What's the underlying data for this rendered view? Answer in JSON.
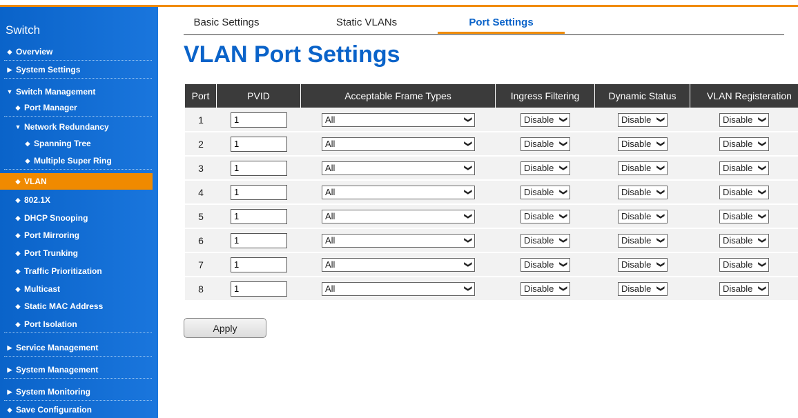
{
  "sidebar": {
    "title": "Switch",
    "items": [
      {
        "label": "Overview",
        "marker": "◆"
      },
      {
        "label": "System Settings",
        "marker": "▶"
      },
      {
        "label": "Switch Management",
        "marker": "▼"
      },
      {
        "label": "Port Manager",
        "marker": "◆"
      },
      {
        "label": "Network Redundancy",
        "marker": "▼"
      },
      {
        "label": "Spanning Tree",
        "marker": "◆"
      },
      {
        "label": "Multiple Super Ring",
        "marker": "◆"
      },
      {
        "label": "VLAN",
        "marker": "◆"
      },
      {
        "label": "802.1X",
        "marker": "◆"
      },
      {
        "label": "DHCP Snooping",
        "marker": "◆"
      },
      {
        "label": "Port Mirroring",
        "marker": "◆"
      },
      {
        "label": "Port Trunking",
        "marker": "◆"
      },
      {
        "label": "Traffic Prioritization",
        "marker": "◆"
      },
      {
        "label": "Multicast",
        "marker": "◆"
      },
      {
        "label": "Static MAC Address",
        "marker": "◆"
      },
      {
        "label": "Port Isolation",
        "marker": "◆"
      },
      {
        "label": "Service Management",
        "marker": "▶"
      },
      {
        "label": "System Management",
        "marker": "▶"
      },
      {
        "label": "System Monitoring",
        "marker": "▶"
      },
      {
        "label": "Save Configuration",
        "marker": "◆"
      }
    ]
  },
  "tabs": [
    "Basic Settings",
    "Static VLANs",
    "Port Settings"
  ],
  "page_title": "VLAN Port Settings",
  "table": {
    "headers": [
      "Port",
      "PVID",
      "Acceptable Frame Types",
      "Ingress Filtering",
      "Dynamic Status",
      "VLAN Registeration"
    ],
    "rows": [
      {
        "port": "1",
        "pvid": "1",
        "frame": "All",
        "ingress": "Disable",
        "dynamic": "Disable",
        "registration": "Disable"
      },
      {
        "port": "2",
        "pvid": "1",
        "frame": "All",
        "ingress": "Disable",
        "dynamic": "Disable",
        "registration": "Disable"
      },
      {
        "port": "3",
        "pvid": "1",
        "frame": "All",
        "ingress": "Disable",
        "dynamic": "Disable",
        "registration": "Disable"
      },
      {
        "port": "4",
        "pvid": "1",
        "frame": "All",
        "ingress": "Disable",
        "dynamic": "Disable",
        "registration": "Disable"
      },
      {
        "port": "5",
        "pvid": "1",
        "frame": "All",
        "ingress": "Disable",
        "dynamic": "Disable",
        "registration": "Disable"
      },
      {
        "port": "6",
        "pvid": "1",
        "frame": "All",
        "ingress": "Disable",
        "dynamic": "Disable",
        "registration": "Disable"
      },
      {
        "port": "7",
        "pvid": "1",
        "frame": "All",
        "ingress": "Disable",
        "dynamic": "Disable",
        "registration": "Disable"
      },
      {
        "port": "8",
        "pvid": "1",
        "frame": "All",
        "ingress": "Disable",
        "dynamic": "Disable",
        "registration": "Disable"
      }
    ]
  },
  "apply_label": "Apply",
  "icons": {
    "dropdown": "chevron-down-icon",
    "bullet": "diamond-bullet-icon",
    "expand": "triangle-right-icon",
    "collapse": "triangle-down-icon"
  },
  "colors": {
    "brand_blue": "#0a63c9",
    "accent_orange": "#f08a00",
    "header_dark": "#3b3b3b",
    "row_bg": "#f2f2f2"
  }
}
